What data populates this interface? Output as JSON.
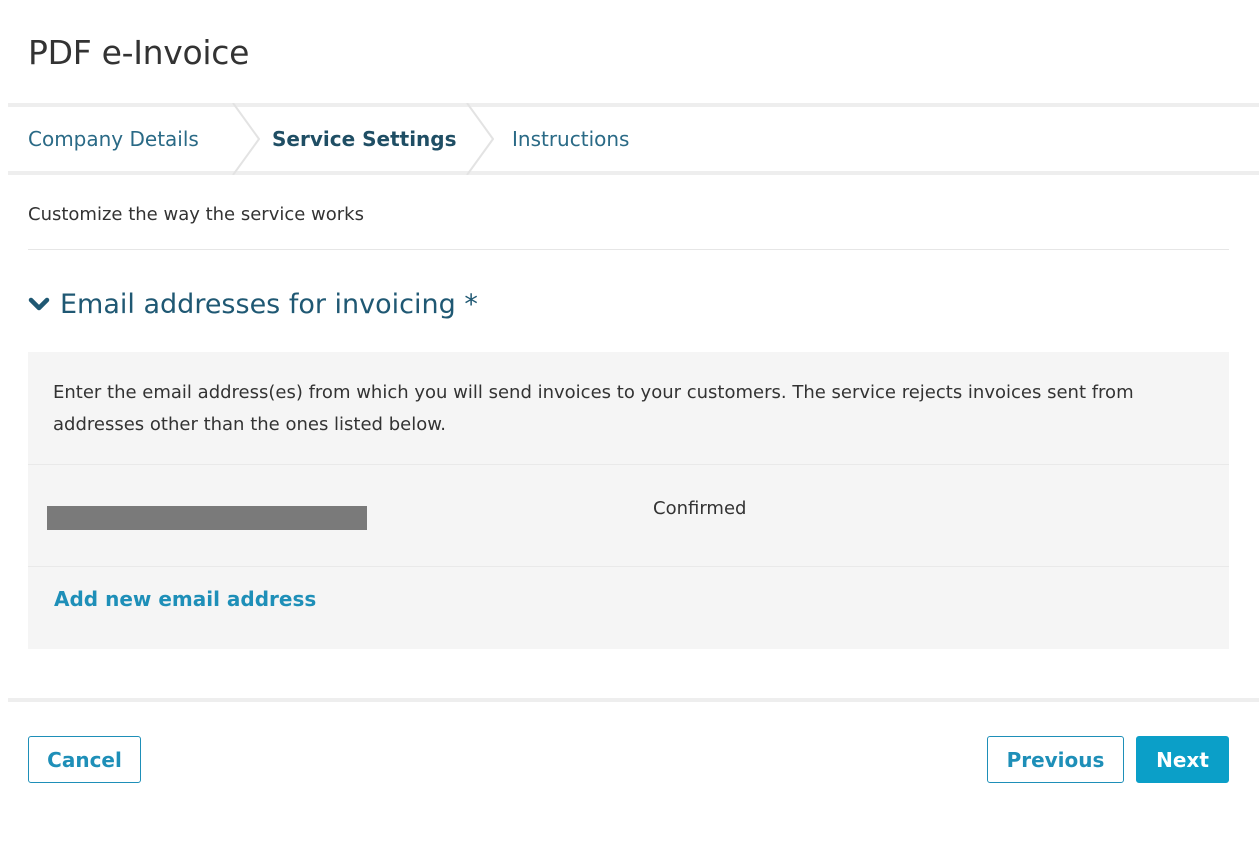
{
  "page": {
    "title": "PDF e-Invoice"
  },
  "wizard": {
    "steps": [
      {
        "label": "Company Details",
        "active": false
      },
      {
        "label": "Service Settings",
        "active": true
      },
      {
        "label": "Instructions",
        "active": false
      }
    ]
  },
  "subtitle": "Customize the way the service works",
  "email_section": {
    "title": "Email addresses for invoicing *",
    "expanded": true,
    "description": "Enter the email address(es) from which you will send invoices to your customers. The service rejects invoices sent from addresses other than the ones listed below.",
    "addresses": [
      {
        "email": "",
        "redacted": true,
        "status": "Confirmed"
      }
    ],
    "add_link": "Add new email address"
  },
  "footer": {
    "cancel_label": "Cancel",
    "previous_label": "Previous",
    "next_label": "Next"
  },
  "colors": {
    "accent": "#0b9fc8",
    "link": "#1e8fb8",
    "heading": "#1f5873",
    "panel_bg": "#f5f5f5"
  }
}
